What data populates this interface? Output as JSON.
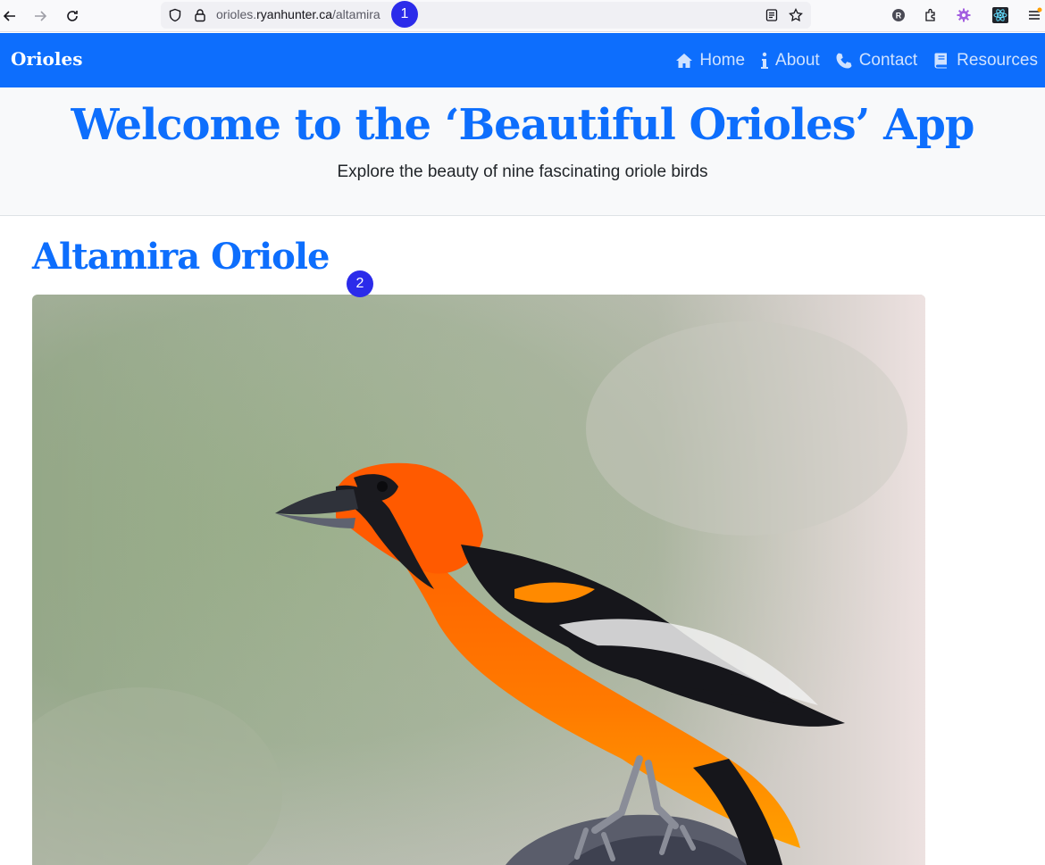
{
  "browser": {
    "url_prefix": "orioles.",
    "url_domain": "ryanhunter.ca",
    "url_path": "/altamira"
  },
  "markers": [
    "1",
    "2"
  ],
  "navbar": {
    "brand": "Orioles",
    "links": [
      {
        "label": "Home",
        "icon": "home-icon"
      },
      {
        "label": "About",
        "icon": "info-icon"
      },
      {
        "label": "Contact",
        "icon": "phone-icon"
      },
      {
        "label": "Resources",
        "icon": "book-icon"
      }
    ]
  },
  "hero": {
    "title": "Welcome to the ‘Beautiful Orioles’ App",
    "subtitle": "Explore the beauty of nine fascinating oriole birds"
  },
  "main": {
    "heading": "Altamira Oriole",
    "image": "altamira-oriole-photo"
  },
  "colors": {
    "primary": "#0d6efd",
    "nav_link": "#cfe2ff",
    "hero_bg": "#f8f9fa",
    "marker": "#2b2bea"
  }
}
